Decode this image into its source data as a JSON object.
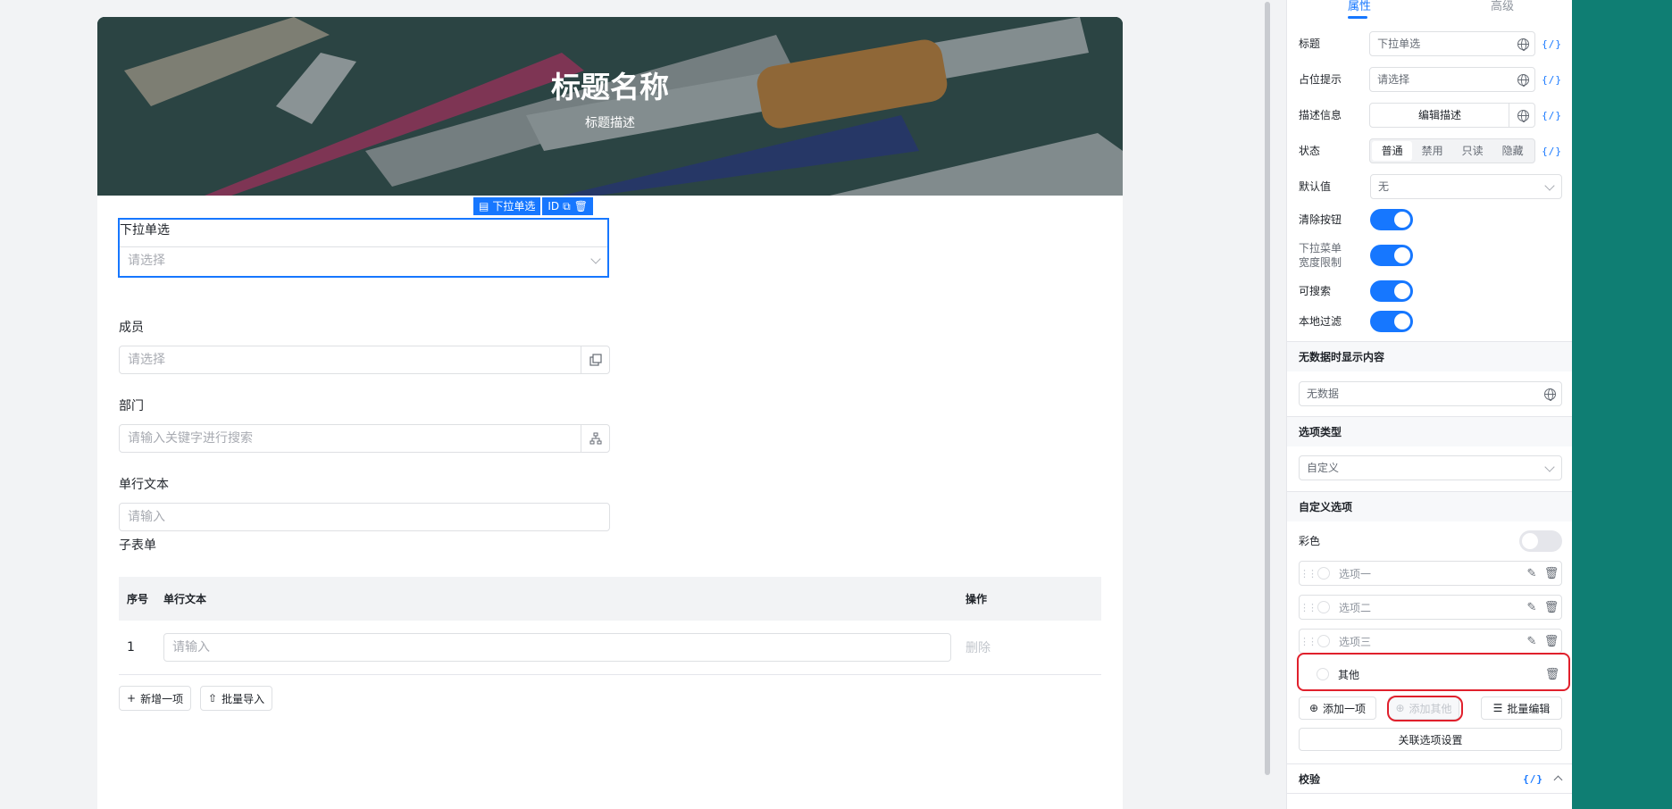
{
  "form": {
    "banner_title": "标题名称",
    "banner_desc": "标题描述",
    "toolbar": {
      "type_label": "下拉单选",
      "id_label": "ID"
    },
    "fields": {
      "dropdown": {
        "label": "下拉单选",
        "placeholder": "请选择"
      },
      "member": {
        "label": "成员",
        "placeholder": "请选择"
      },
      "department": {
        "label": "部门",
        "placeholder": "请输入关键字进行搜索"
      },
      "text": {
        "label": "单行文本",
        "placeholder": "请输入"
      }
    },
    "subtable": {
      "label": "子表单",
      "columns": [
        "序号",
        "单行文本",
        "操作"
      ],
      "rows": [
        {
          "index": "1",
          "placeholder": "请输入",
          "action": "删除"
        }
      ],
      "add_button": "新增一项",
      "import_button": "批量导入"
    }
  },
  "panel": {
    "tabs": [
      "属性",
      "高级"
    ],
    "title": {
      "label": "标题",
      "value": "下拉单选"
    },
    "placeholder": {
      "label": "占位提示",
      "value": "请选择"
    },
    "description": {
      "label": "描述信息",
      "button": "编辑描述"
    },
    "expr_label": "{/}",
    "status": {
      "label": "状态",
      "options": [
        "普通",
        "禁用",
        "只读",
        "隐藏"
      ],
      "selected": "普通"
    },
    "default_value": {
      "label": "默认值",
      "value": "无"
    },
    "toggles": {
      "clear_button": {
        "label": "清除按钮",
        "on": true
      },
      "width_limit": {
        "label_line1": "下拉菜单",
        "label_line2": "宽度限制",
        "on": true
      },
      "searchable": {
        "label": "可搜索",
        "on": true
      },
      "local_filter": {
        "label": "本地过滤",
        "on": true
      }
    },
    "no_data": {
      "heading": "无数据时显示内容",
      "value": "无数据"
    },
    "option_type": {
      "heading": "选项类型",
      "value": "自定义"
    },
    "custom_options": {
      "heading": "自定义选项",
      "colorful_label": "彩色",
      "colorful_on": false,
      "items": [
        "选项一",
        "选项二",
        "选项三"
      ],
      "other": "其他",
      "add_item": "添加一项",
      "add_other": "添加其他",
      "batch_edit": "批量编辑",
      "linked_settings": "关联选项设置"
    },
    "validation": {
      "heading": "校验"
    }
  },
  "colors": {
    "accent": "#1677ff",
    "highlight": "#e0202c",
    "teal": "#0f7e73"
  }
}
